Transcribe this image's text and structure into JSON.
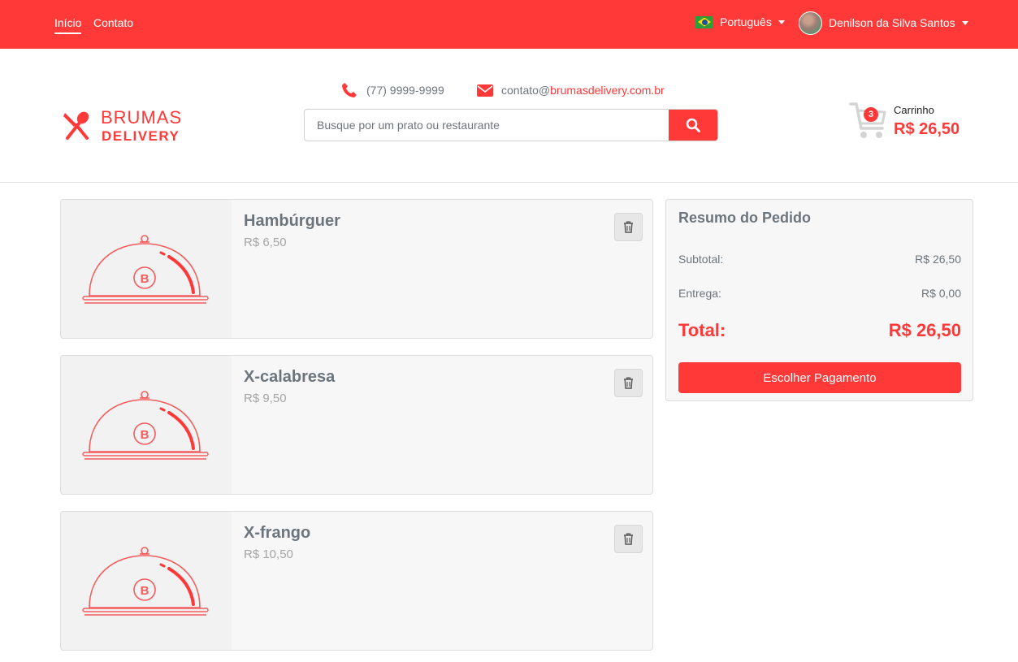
{
  "nav": {
    "links": [
      "Início",
      "Contato"
    ],
    "language": "Português",
    "user_name": "Denilson da Silva Santos"
  },
  "header": {
    "logo_line1": "BRUMAS",
    "logo_line2": "DELIVERY",
    "phone": "(77) 9999-9999",
    "email_user": "contato@",
    "email_domain": "brumasdelivery.com.br",
    "search_placeholder": "Busque por um prato ou restaurante",
    "cart_count": "3",
    "cart_label": "Carrinho",
    "cart_total": "R$ 26,50"
  },
  "items": [
    {
      "name": "Hambúrguer",
      "price": "R$ 6,50"
    },
    {
      "name": "X-calabresa",
      "price": "R$ 9,50"
    },
    {
      "name": "X-frango",
      "price": "R$ 10,50"
    }
  ],
  "summary": {
    "title": "Resumo do Pedido",
    "subtotal_label": "Subtotal:",
    "subtotal_value": "R$ 26,50",
    "delivery_label": "Entrega:",
    "delivery_value": "R$ 0,00",
    "total_label": "Total:",
    "total_value": "R$ 26,50",
    "pay_button": "Escolher Pagamento"
  },
  "colors": {
    "accent": "#ff3838",
    "text_muted": "#6c757d"
  }
}
